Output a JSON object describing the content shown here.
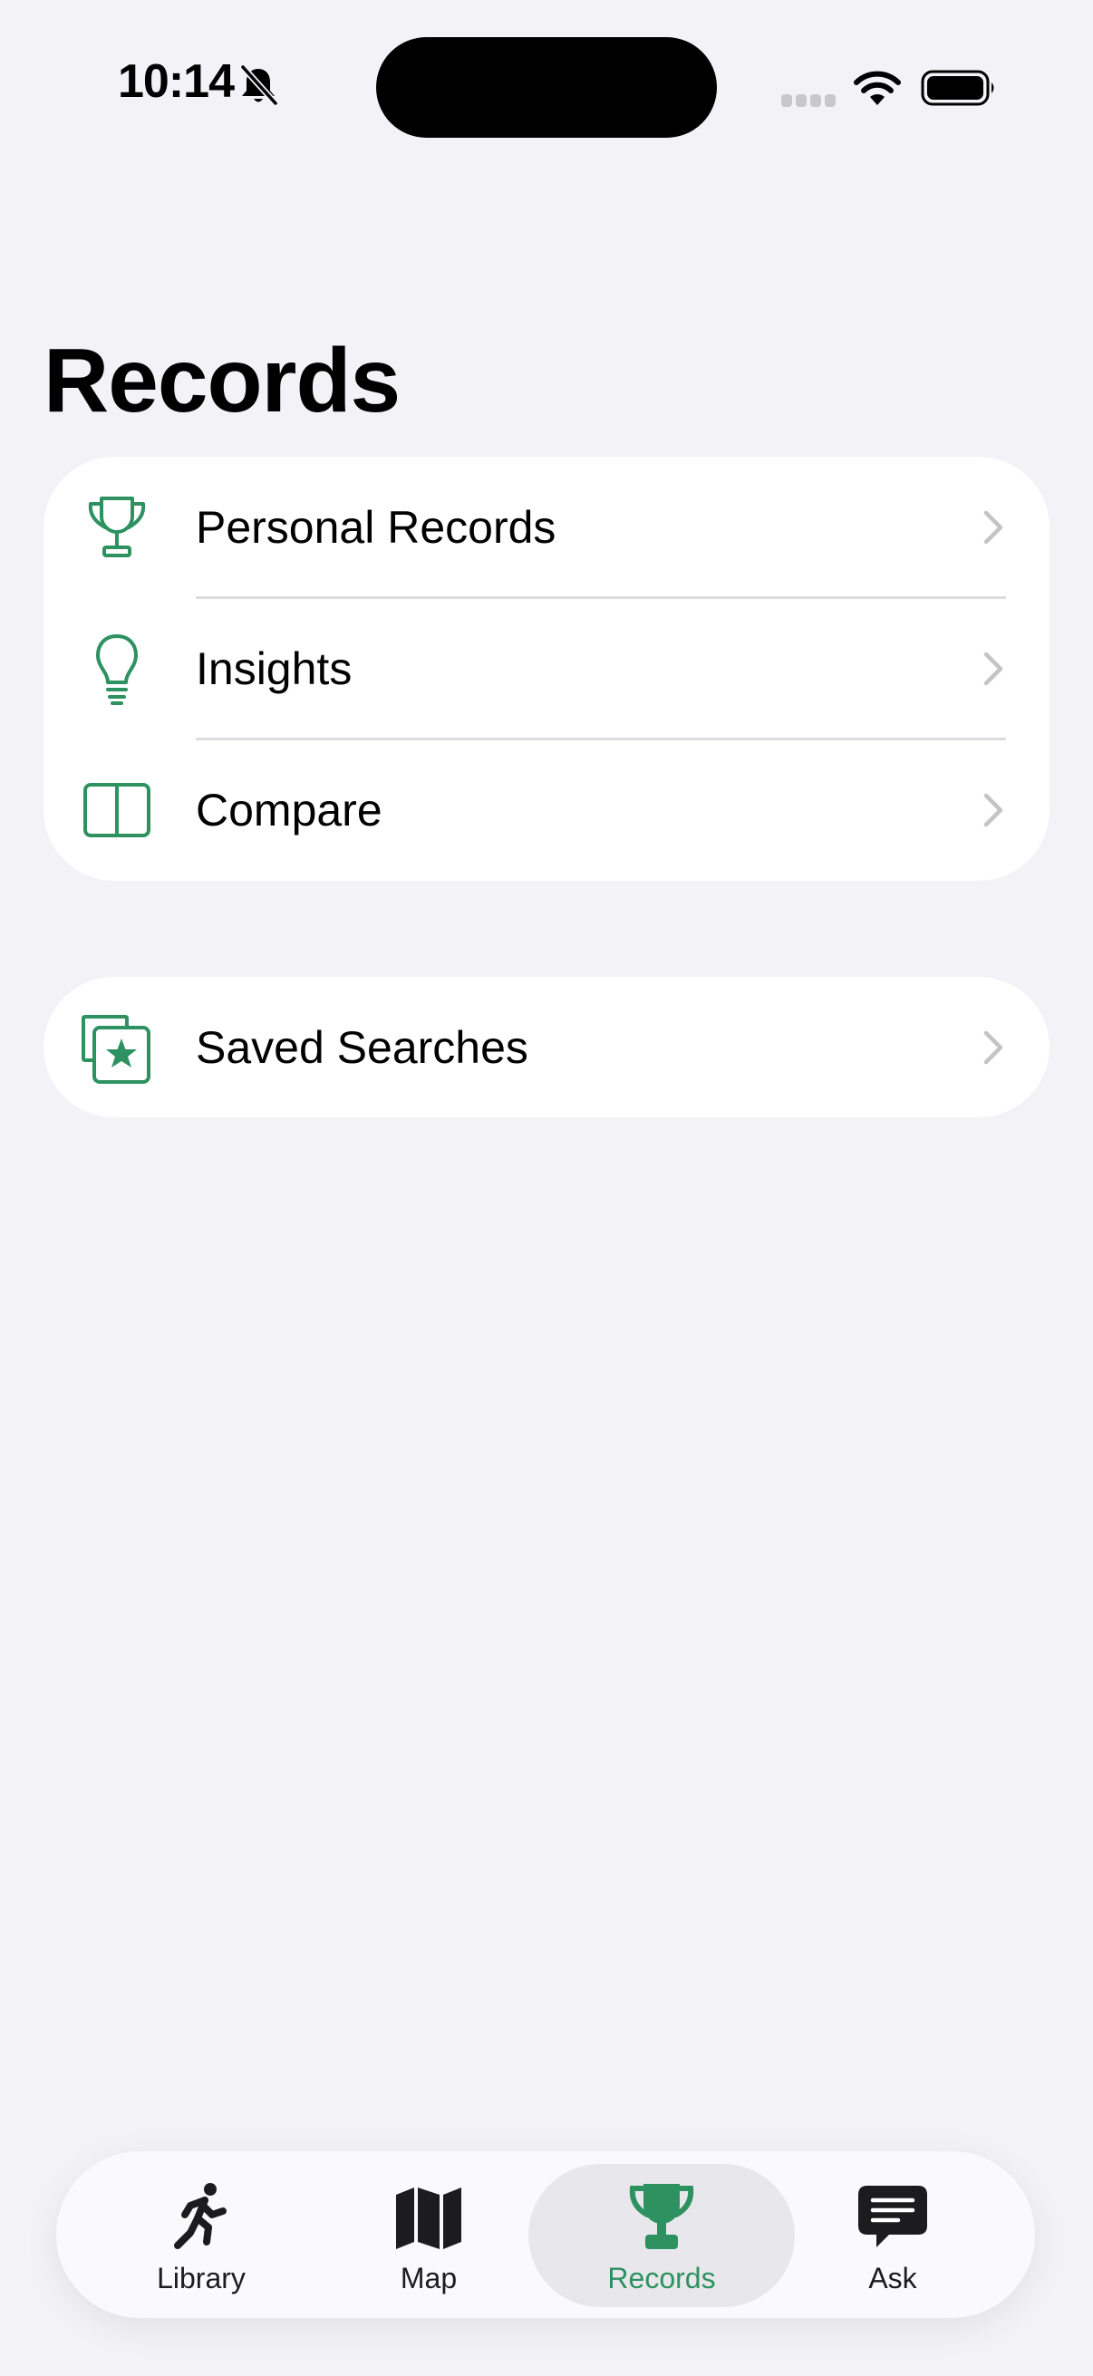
{
  "status_bar": {
    "time": "10:14",
    "icons": [
      "bell-slash-icon",
      "cellular-signal-icon",
      "wifi-icon",
      "battery-icon"
    ]
  },
  "page": {
    "title": "Records"
  },
  "main_menu": {
    "items": [
      {
        "label": "Personal Records",
        "icon": "trophy-icon"
      },
      {
        "label": "Insights",
        "icon": "lightbulb-icon"
      },
      {
        "label": "Compare",
        "icon": "split-rectangle-icon"
      }
    ]
  },
  "secondary_menu": {
    "items": [
      {
        "label": "Saved Searches",
        "icon": "star-stack-icon"
      }
    ]
  },
  "tab_bar": {
    "selected": "Records",
    "tabs": [
      {
        "label": "Library",
        "icon": "running-figure-icon"
      },
      {
        "label": "Map",
        "icon": "map-icon"
      },
      {
        "label": "Records",
        "icon": "trophy-fill-icon"
      },
      {
        "label": "Ask",
        "icon": "chat-bubble-icon"
      }
    ]
  },
  "colors": {
    "accent": "#2e9160",
    "background": "#f2f2f7",
    "card": "#ffffff",
    "chevron": "#c4c4c7"
  }
}
